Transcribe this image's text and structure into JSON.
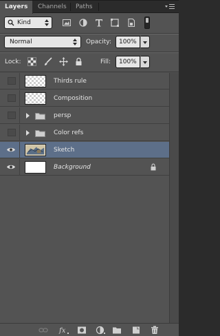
{
  "tabs": [
    {
      "label": "Layers",
      "active": true
    },
    {
      "label": "Channels",
      "active": false
    },
    {
      "label": "Paths",
      "active": false
    }
  ],
  "filter": {
    "kind_label": "Kind",
    "icons": [
      "image-filter-icon",
      "adjustment-filter-icon",
      "type-filter-icon",
      "shape-filter-icon",
      "smart-object-filter-icon"
    ]
  },
  "blend": {
    "mode": "Normal",
    "opacity_label": "Opacity:",
    "opacity_value": "100%",
    "fill_label": "Fill:",
    "fill_value": "100%"
  },
  "lock": {
    "label": "Lock:",
    "icons": [
      "lock-transparent-pixels-icon",
      "lock-image-pixels-icon",
      "lock-position-icon",
      "lock-all-icon"
    ]
  },
  "layers": [
    {
      "name": "Thirds rule",
      "type": "layer",
      "visible": false,
      "thumb": "transparent"
    },
    {
      "name": "Composition",
      "type": "layer",
      "visible": false,
      "thumb": "transparent"
    },
    {
      "name": "persp",
      "type": "group",
      "visible": false
    },
    {
      "name": "Color refs",
      "type": "group",
      "visible": false
    },
    {
      "name": "Sketch",
      "type": "layer",
      "visible": true,
      "selected": true,
      "thumb": "sketch"
    },
    {
      "name": "Background",
      "type": "background",
      "visible": true,
      "thumb": "white",
      "locked": true
    }
  ],
  "bottom_toolbar": [
    "link-layers-icon",
    "fx-icon",
    "layer-mask-icon",
    "adjustment-layer-icon",
    "new-group-icon",
    "new-layer-icon",
    "trash-icon"
  ],
  "colors": {
    "panel_bg": "#535353",
    "selected_row": "#5d6f89",
    "tab_bar": "#2b2b2b"
  }
}
